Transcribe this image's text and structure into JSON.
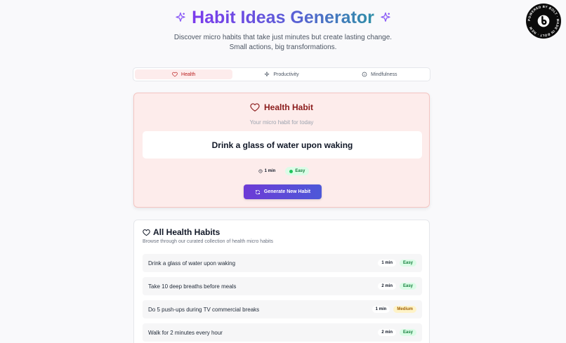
{
  "header": {
    "title": "Habit Ideas Generator",
    "subtitle": "Discover micro habits that take just minutes but create lasting change. Small actions, big transformations."
  },
  "tabs": [
    {
      "label": "Health",
      "icon": "heart-icon",
      "active": true
    },
    {
      "label": "Productivity",
      "icon": "sparkle-icon",
      "active": false
    },
    {
      "label": "Mindfulness",
      "icon": "info-icon",
      "active": false
    }
  ],
  "habit_card": {
    "title": "Health Habit",
    "subtitle": "Your micro habit for today",
    "habit": "Drink a glass of water upon waking",
    "time": "1 min",
    "difficulty": "Easy",
    "button_label": "Generate New Habit"
  },
  "list": {
    "title": "All Health Habits",
    "subtitle": "Browse through our curated collection of health micro habits",
    "items": [
      {
        "text": "Drink a glass of water upon waking",
        "time": "1 min",
        "difficulty": "Easy"
      },
      {
        "text": "Take 10 deep breaths before meals",
        "time": "2 min",
        "difficulty": "Easy"
      },
      {
        "text": "Do 5 push-ups during TV commercial breaks",
        "time": "1 min",
        "difficulty": "Medium"
      },
      {
        "text": "Walk for 2 minutes every hour",
        "time": "2 min",
        "difficulty": "Easy"
      }
    ]
  },
  "badge": {
    "text": "POWERED BY BOLT · MADE IN BOLT · NEW",
    "icon": "bolt-logo-icon"
  },
  "colors": {
    "accent": "#6d3bd6",
    "health": "#b91c1c",
    "easy": "#15803d",
    "medium": "#a16207"
  }
}
